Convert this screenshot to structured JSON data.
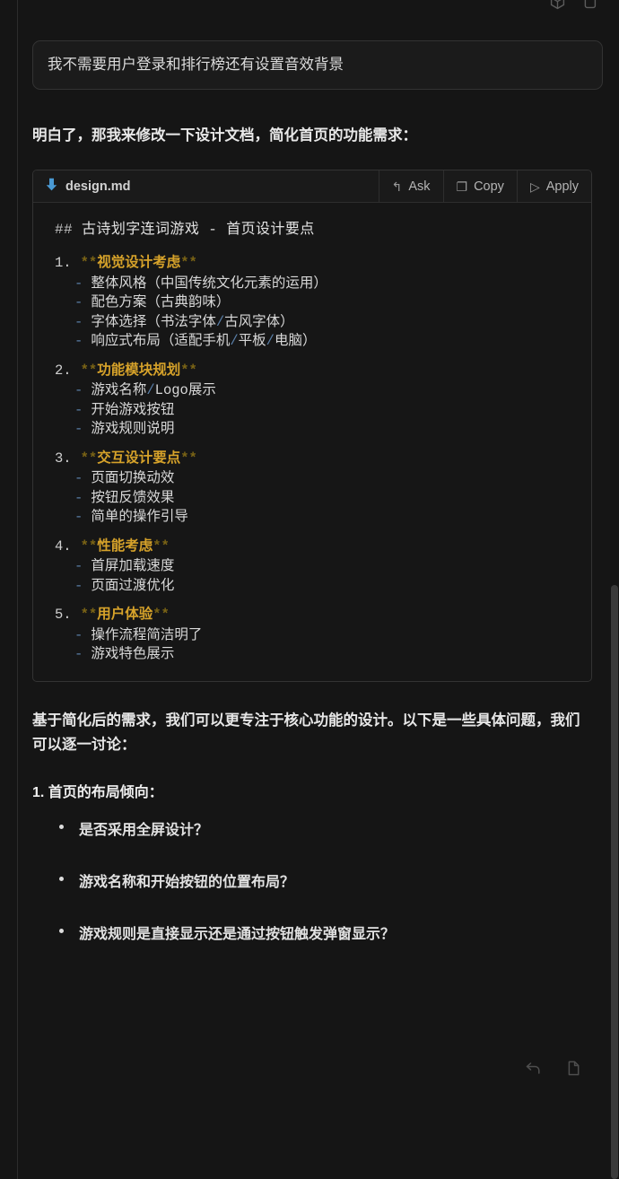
{
  "theme": {
    "page_bg": "#151515",
    "card_bg": "#161616",
    "border": "#333333",
    "text": "#e2e2e2",
    "accent_bold": "#d6a22a",
    "accent_dash": "#5a7fa8",
    "scrollbar": "#3a3a3a"
  },
  "top_icons": [
    {
      "name": "box-icon",
      "glyph": "⬔"
    },
    {
      "name": "copy-icon",
      "glyph": "❐"
    }
  ],
  "user_message": {
    "text": "我不需要用户登录和排行榜还有设置音效背景"
  },
  "assistant_intro": {
    "text": "明白了，那我来修改一下设计文档，简化首页的功能需求："
  },
  "code_card": {
    "file_icon": "download-arrow-icon",
    "filename": "design.md",
    "actions": [
      {
        "glyph": "↰",
        "label": "Ask",
        "icon": "ask-arrow-icon"
      },
      {
        "glyph": "❐",
        "label": "Copy",
        "icon": "copy-icon"
      },
      {
        "glyph": "▷",
        "label": "Apply",
        "icon": "play-icon"
      }
    ],
    "heading": {
      "hash": "##",
      "text": "古诗划字连词游戏 - 首页设计要点"
    },
    "sections": [
      {
        "num": "1.",
        "title": "视觉设计考虑",
        "items": [
          "整体风格（中国传统文化元素的运用）",
          "配色方案（古典韵味）",
          "字体选择（书法字体/古风字体）",
          "响应式布局（适配手机/平板/电脑）"
        ]
      },
      {
        "num": "2.",
        "title": "功能模块规划",
        "items": [
          "游戏名称/Logo展示",
          "开始游戏按钮",
          "游戏规则说明"
        ]
      },
      {
        "num": "3.",
        "title": "交互设计要点",
        "items": [
          "页面切换动效",
          "按钮反馈效果",
          "简单的操作引导"
        ]
      },
      {
        "num": "4.",
        "title": "性能考虑",
        "items": [
          "首屏加载速度",
          "页面过渡优化"
        ]
      },
      {
        "num": "5.",
        "title": "用户体验",
        "items": [
          "操作流程简洁明了",
          "游戏特色展示"
        ]
      }
    ]
  },
  "closing": {
    "paragraph": "基于简化后的需求，我们可以更专注于核心功能的设计。以下是一些具体问题，我们可以逐一讨论：",
    "list_heading": "1. 首页的布局倾向：",
    "questions": [
      "是否采用全屏设计？",
      "游戏名称和开始按钮的位置布局？",
      "游戏规则是直接显示还是通过按钮触发弹窗显示？"
    ]
  },
  "message_actions": [
    {
      "name": "retry-icon",
      "glyph": "↰"
    },
    {
      "name": "copy-icon",
      "glyph": "❐"
    }
  ]
}
